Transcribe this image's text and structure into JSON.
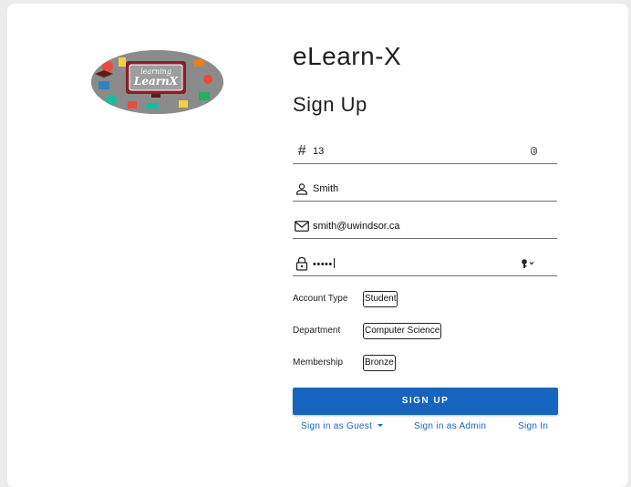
{
  "app": {
    "title": "eLearn-X",
    "logo_text_top": "learning",
    "logo_text_bottom": "LearnX"
  },
  "form": {
    "title": "Sign Up",
    "id_field": {
      "value": "13",
      "icon": "hash-icon"
    },
    "name_field": {
      "value": "Smith",
      "icon": "person-icon"
    },
    "email_field": {
      "value": "smith@uwindsor.ca",
      "icon": "mail-icon"
    },
    "password_field": {
      "value": "•••••",
      "icon": "lock-icon"
    },
    "account_type": {
      "label": "Account Type",
      "value": "Student"
    },
    "department": {
      "label": "Department",
      "value": "Computer Science"
    },
    "membership": {
      "label": "Membership",
      "value": "Bronze"
    },
    "submit_label": "SIGN UP"
  },
  "links": {
    "guest": "Sign in as Guest",
    "admin": "Sign in as Admin",
    "signin": "Sign In"
  },
  "colors": {
    "primary": "#1565c0",
    "background": "#ececec",
    "card": "#ffffff"
  }
}
